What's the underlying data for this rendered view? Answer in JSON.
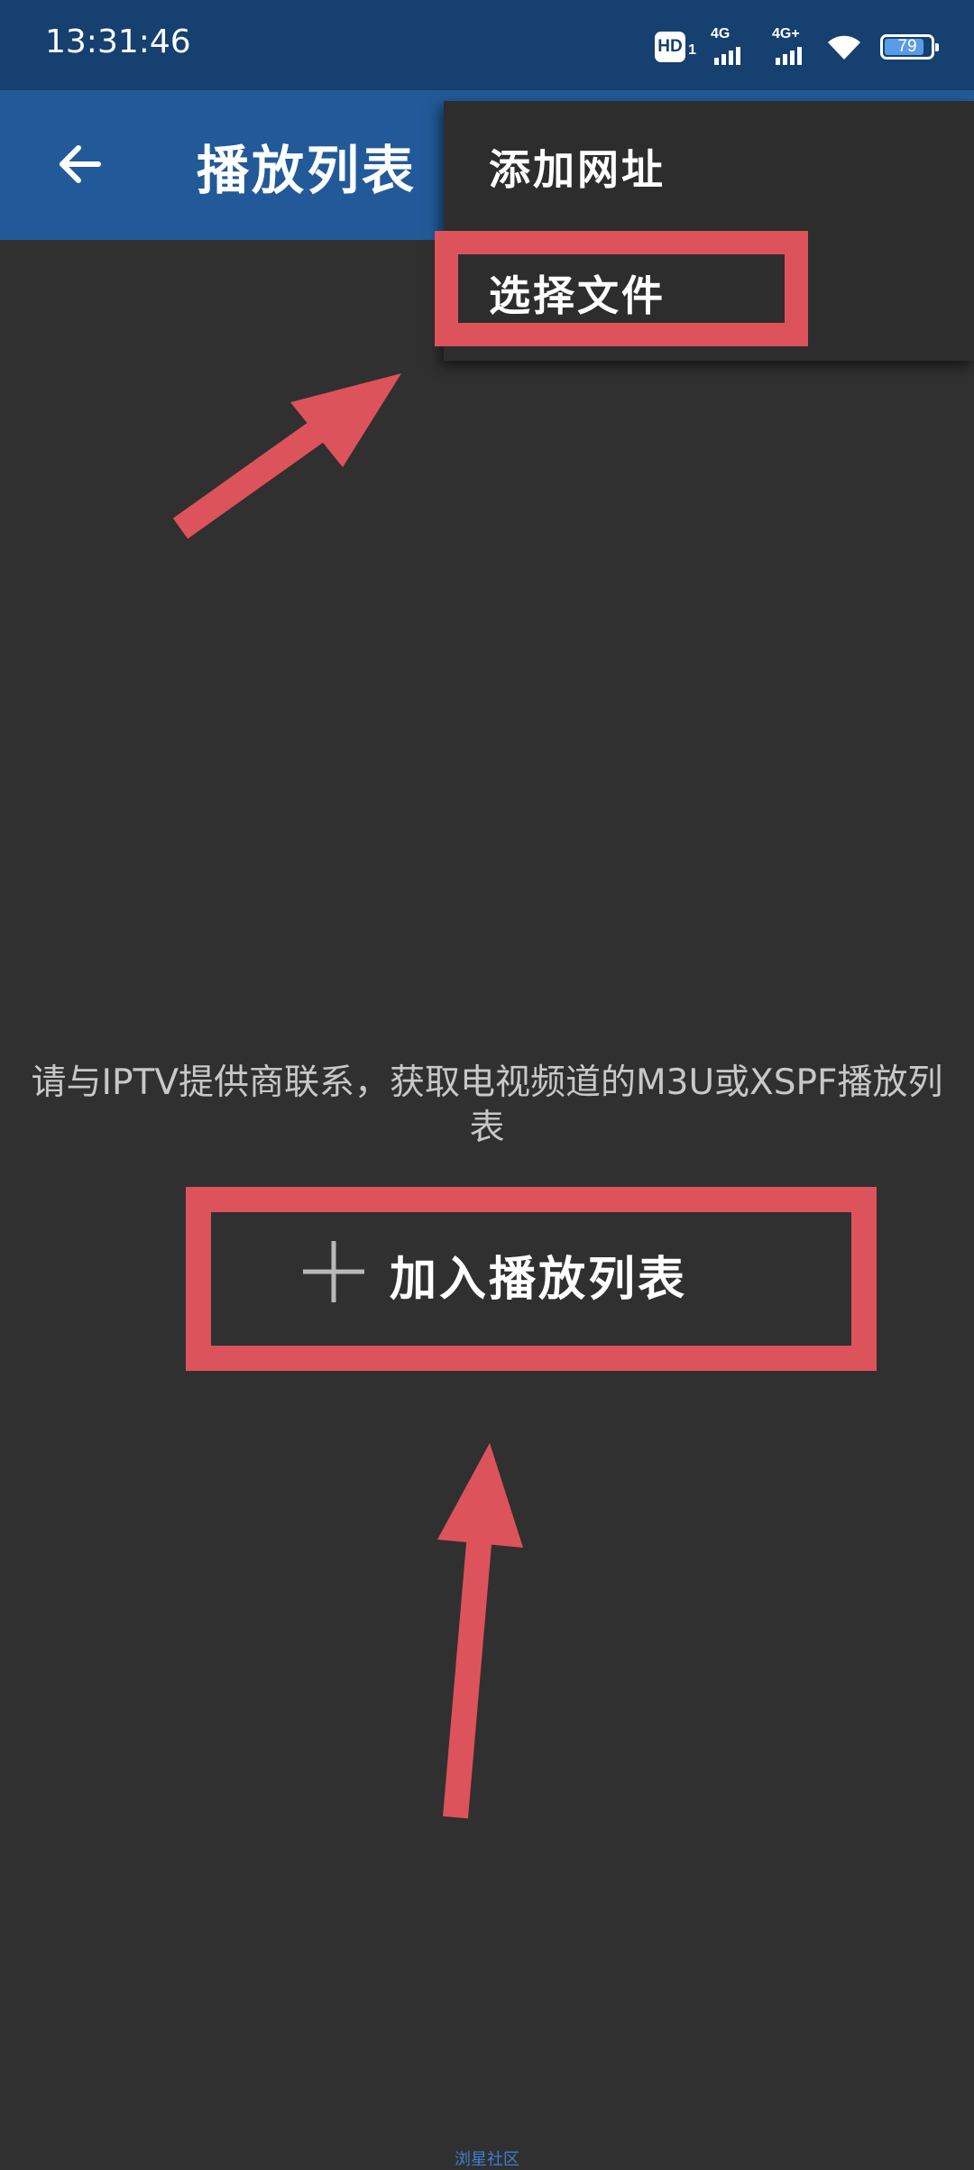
{
  "status_bar": {
    "time": "13:31:46",
    "hd_label": "HD",
    "hd_sub": "1",
    "signal_1_label": "4G",
    "signal_2_label": "4G+",
    "battery_level": "79"
  },
  "app_bar": {
    "title": "播放列表",
    "back_icon": "arrow-left-icon"
  },
  "menu": {
    "items": [
      {
        "label": "添加网址"
      },
      {
        "label": "选择文件"
      }
    ]
  },
  "main": {
    "hint": "请与IPTV提供商联系，获取电视频道的M3U或XSPF播放列表",
    "add_button_label": "加入播放列表",
    "add_icon": "plus-icon"
  },
  "watermark": "浏星社区",
  "colors": {
    "status_bar": "#15406f",
    "app_bar": "#225a99",
    "background": "#303030",
    "menu_background": "#2d2d2d",
    "annotation": "#dd535b"
  }
}
